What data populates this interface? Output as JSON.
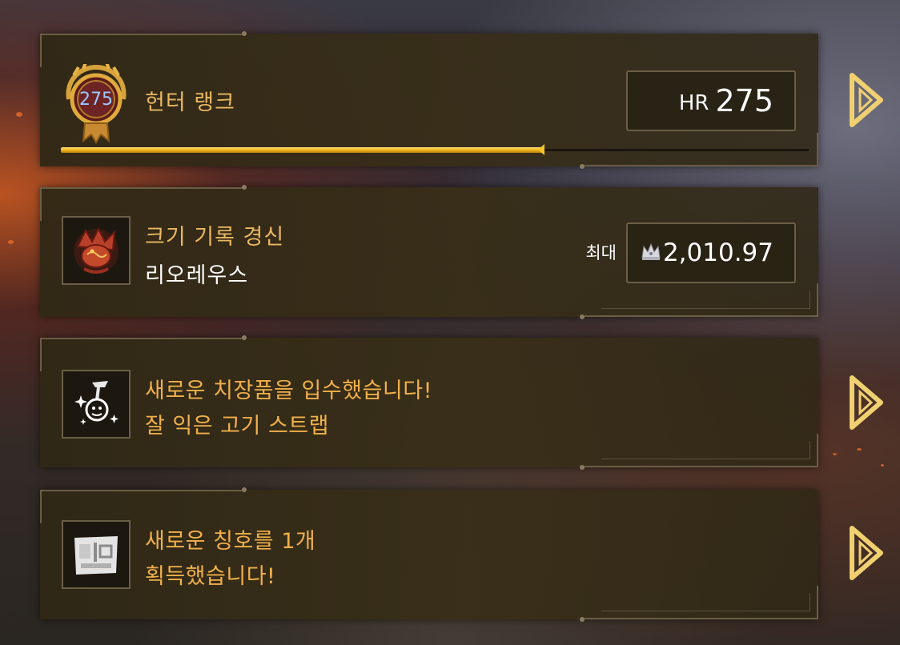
{
  "hunter_rank": {
    "badge_number": "275",
    "title": "헌터 랭크",
    "hr_label": "HR",
    "hr_value": "275",
    "progress_fraction": 0.645
  },
  "size_record": {
    "title": "크기 기록 경신",
    "monster": "리오레우스",
    "max_label": "최대",
    "max_value": "2,010.97"
  },
  "charm": {
    "line1": "새로운 치장품을 입수했습니다!",
    "line2": "잘 익은 고기 스트랩"
  },
  "titles": {
    "line1": "새로운 칭호를 1개",
    "line2": "획득했습니다!"
  },
  "colors": {
    "gold_text": "#e9b862",
    "orange_text": "#f2b04a",
    "bar_fill": "#f0b418",
    "panel": "#302816"
  },
  "icons": [
    "hunter-rank-medal-icon",
    "rathalos-icon",
    "charm-icon",
    "title-card-icon",
    "crown-icon",
    "next-arrow-icon"
  ]
}
